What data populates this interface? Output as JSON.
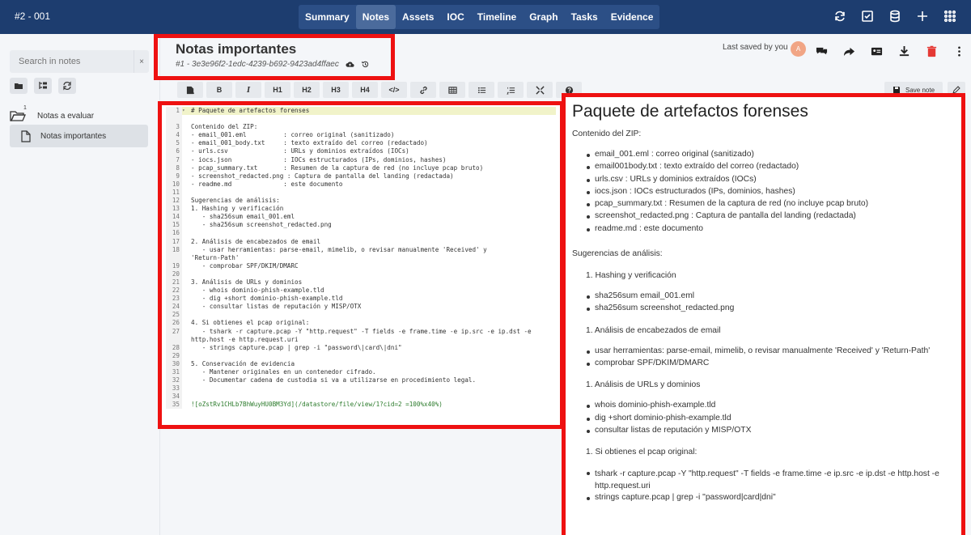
{
  "header": {
    "case_id": "#2 - 001",
    "tabs": [
      {
        "label": "Summary"
      },
      {
        "label": "Notes",
        "active": true
      },
      {
        "label": "Assets"
      },
      {
        "label": "IOC"
      },
      {
        "label": "Timeline"
      },
      {
        "label": "Graph"
      },
      {
        "label": "Tasks"
      },
      {
        "label": "Evidence"
      }
    ],
    "right_icons": [
      "refresh-icon",
      "checkbox-icon",
      "database-icon",
      "plus-icon",
      "grid-icon"
    ],
    "bar_color": "#1d3d6f"
  },
  "sidebar": {
    "search_placeholder": "Search in notes",
    "clear_label": "×",
    "buttons": [
      "add-note-icon",
      "add-directory-icon",
      "refresh-icon"
    ],
    "folder": {
      "count": "1",
      "label": "Notas a evaluar"
    },
    "note": {
      "label": "Notas importantes"
    }
  },
  "note": {
    "title": "Notas importantes",
    "uuid": "#1 - 3e3e96f2-1edc-4239-b692-9423ad4ffaec",
    "saved_by": "Last saved by you",
    "avatar_initial": "A",
    "action_icons": [
      "comments-icon",
      "share-icon",
      "id-card-icon",
      "download-icon",
      "trash-icon",
      "more-icon"
    ],
    "save_label": "Save note"
  },
  "toolbar": {
    "buttons": [
      {
        "name": "assistant-icon",
        "label": ""
      },
      {
        "name": "bold-button",
        "label": "B"
      },
      {
        "name": "italic-button",
        "label": "I"
      },
      {
        "name": "h1-button",
        "label": "H1"
      },
      {
        "name": "h2-button",
        "label": "H2"
      },
      {
        "name": "h3-button",
        "label": "H3"
      },
      {
        "name": "h4-button",
        "label": "H4"
      },
      {
        "name": "code-icon",
        "label": "</>"
      },
      {
        "name": "link-icon",
        "label": ""
      },
      {
        "name": "table-icon",
        "label": ""
      },
      {
        "name": "list-icon",
        "label": ""
      },
      {
        "name": "ordered-list-icon",
        "label": ""
      },
      {
        "name": "fullscreen-icon",
        "label": ""
      },
      {
        "name": "help-icon",
        "label": ""
      }
    ]
  },
  "editor": {
    "lines": [
      "# Paquete de artefactos forenses",
      "",
      "Contenido del ZIP:",
      "- email_001.eml          : correo original (sanitizado)",
      "- email_001_body.txt     : texto extraído del correo (redactado)",
      "- urls.csv               : URLs y dominios extraídos (IOCs)",
      "- iocs.json              : IOCs estructurados (IPs, dominios, hashes)",
      "- pcap_summary.txt       : Resumen de la captura de red (no incluye pcap bruto)",
      "- screenshot_redacted.png : Captura de pantalla del landing (redactada)",
      "- readme.md              : este documento",
      "",
      "Sugerencias de análisis:",
      "1. Hashing y verificación",
      "   - sha256sum email_001.eml",
      "   - sha256sum screenshot_redacted.png",
      "",
      "2. Análisis de encabezados de email",
      "   - usar herramientas: parse-email, mimelib, o revisar manualmente 'Received' y",
      "'Return-Path'",
      "   - comprobar SPF/DKIM/DMARC",
      "",
      "3. Análisis de URLs y dominios",
      "   - whois dominio-phish-example.tld",
      "   - dig +short dominio-phish-example.tld",
      "   - consultar listas de reputación y MISP/OTX",
      "",
      "4. Si obtienes el pcap original:",
      "   - tshark -r capture.pcap -Y \"http.request\" -T fields -e frame.time -e ip.src -e ip.dst -e",
      "http.host -e http.request.uri",
      "   - strings capture.pcap | grep -i \"password\\|card\\|dni\"",
      "",
      "5. Conservación de evidencia",
      "   - Mantener originales en un contenedor cifrado.",
      "   - Documentar cadena de custodia si va a utilizarse en procedimiento legal.",
      "",
      "",
      "![oZstRv1CHLb7BhWuyHU0BM3Yd](/datastore/file/view/1?cid=2 =100%x40%)"
    ],
    "line_numbers": [
      "1",
      "",
      "3",
      "4",
      "5",
      "6",
      "7",
      "8",
      "9",
      "10",
      "11",
      "12",
      "13",
      "14",
      "15",
      "16",
      "17",
      "18",
      "",
      "19",
      "20",
      "21",
      "22",
      "23",
      "24",
      "25",
      "26",
      "27",
      "",
      "28",
      "29",
      "30",
      "31",
      "32",
      "33",
      "34",
      "35"
    ]
  },
  "preview": {
    "title": "Paquete de artefactos forenses",
    "intro": "Contenido del ZIP:",
    "zip_items": [
      "email_001.eml : correo original (sanitizado)",
      "email001body.txt : texto extraído del correo (redactado)",
      "urls.csv : URLs y dominios extraídos (IOCs)",
      "iocs.json : IOCs estructurados (IPs, dominios, hashes)",
      "pcap_summary.txt : Resumen de la captura de red (no incluye pcap bruto)",
      "screenshot_redacted.png : Captura de pantalla del landing (redactada)",
      "readme.md : este documento"
    ],
    "suggestions": "Sugerencias de análisis:",
    "sections": [
      {
        "heading": "1. Hashing y verificación",
        "items": [
          "sha256sum email_001.eml",
          "sha256sum screenshot_redacted.png"
        ]
      },
      {
        "heading": "1. Análisis de encabezados de email",
        "items": [
          "usar herramientas: parse-email, mimelib, o revisar manualmente 'Received' y 'Return-Path'",
          "comprobar SPF/DKIM/DMARC"
        ]
      },
      {
        "heading": "1. Análisis de URLs y dominios",
        "items": [
          "whois dominio-phish-example.tld",
          "dig +short dominio-phish-example.tld",
          "consultar listas de reputación y MISP/OTX"
        ]
      },
      {
        "heading": "1. Si obtienes el pcap original:",
        "items": [
          "tshark -r capture.pcap -Y \"http.request\" -T fields -e frame.time -e ip.src -e ip.dst -e http.host -e http.request.uri",
          "strings capture.pcap | grep -i \"password|card|dni\""
        ]
      }
    ]
  }
}
